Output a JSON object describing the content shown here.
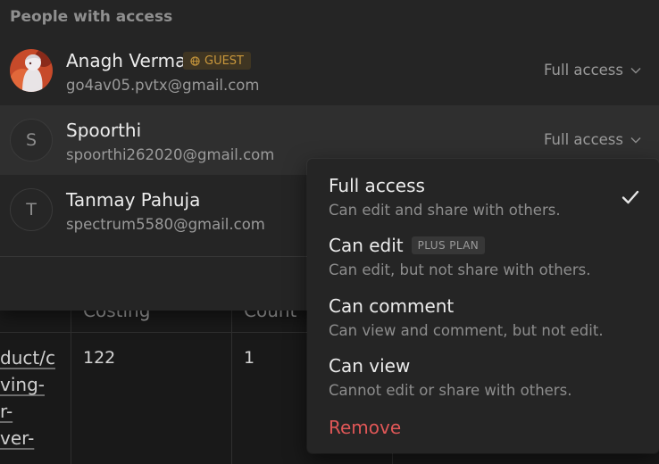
{
  "table": {
    "headers": [
      "Costing",
      "Count"
    ],
    "rows": [
      {
        "costing": "122",
        "count": "1"
      }
    ],
    "link_fragments": [
      "duct/c",
      "ving-",
      "r-",
      "ver-"
    ]
  },
  "panel": {
    "title": "People with access",
    "people": [
      {
        "name": "Anagh Verma",
        "email": "go4av05.pvtx@gmail.com",
        "badge": "GUEST",
        "access": "Full access",
        "avatar_type": "image"
      },
      {
        "name": "Spoorthi",
        "email": "spoorthi262020@gmail.com",
        "access": "Full access",
        "avatar_letter": "S"
      },
      {
        "name": "Tanmay Pahuja",
        "email": "spectrum5580@gmail.com",
        "avatar_letter": "T"
      }
    ]
  },
  "dropdown": {
    "options": [
      {
        "title": "Full access",
        "description": "Can edit and share with others.",
        "selected": true
      },
      {
        "title": "Can edit",
        "badge": "PLUS PLAN",
        "description": "Can edit, but not share with others."
      },
      {
        "title": "Can comment",
        "description": "Can view and comment, but not edit."
      },
      {
        "title": "Can view",
        "description": "Cannot edit or share with others."
      }
    ],
    "remove_label": "Remove"
  },
  "icons": {
    "guest": "globe-icon",
    "select": "chevron-down-icon",
    "selected": "check-icon"
  },
  "colors": {
    "background": "#191919",
    "panel": "#252525",
    "hover_row": "#2f2f2f",
    "guest_badge_text": "#c8973c",
    "remove": "#e05757"
  }
}
